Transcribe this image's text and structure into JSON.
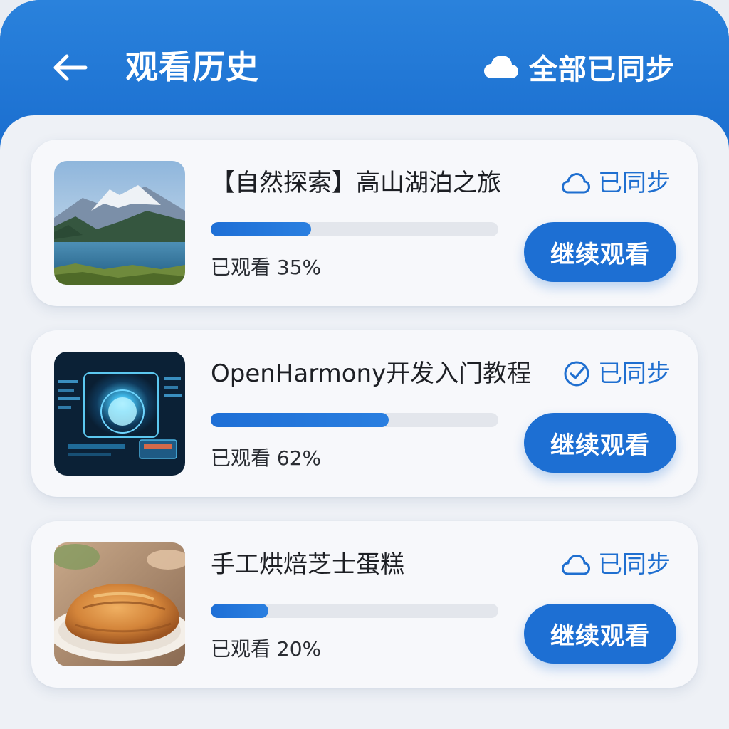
{
  "header": {
    "title": "观看历史",
    "back_icon": "arrow-left-icon",
    "sync_status_label": "全部已同步",
    "sync_icon": "cloud-icon"
  },
  "colors": {
    "accent": "#1d6fd3",
    "header_bg": "#2a82dc",
    "card_bg": "#f7f8fb",
    "progress_track": "#e3e6ec"
  },
  "history": [
    {
      "title": "【自然探索】高山湖泊之旅",
      "sync_label": "已同步",
      "sync_icon": "cloud-icon",
      "progress": 0.35,
      "progress_text": "已观看 35%",
      "action_label": "继续观看",
      "thumbnail": "mountain-lake-thumbnail"
    },
    {
      "title": "OpenHarmony开发入门教程",
      "sync_label": "已同步",
      "sync_icon": "check-circle-icon",
      "progress": 0.62,
      "progress_text": "已观看 62%",
      "action_label": "继续观看",
      "thumbnail": "tech-interface-thumbnail"
    },
    {
      "title": "手工烘焙芝士蛋糕",
      "sync_label": "已同步",
      "sync_icon": "cloud-icon",
      "progress": 0.2,
      "progress_text": "已观看 20%",
      "action_label": "继续观看",
      "thumbnail": "pastry-thumbnail"
    }
  ]
}
